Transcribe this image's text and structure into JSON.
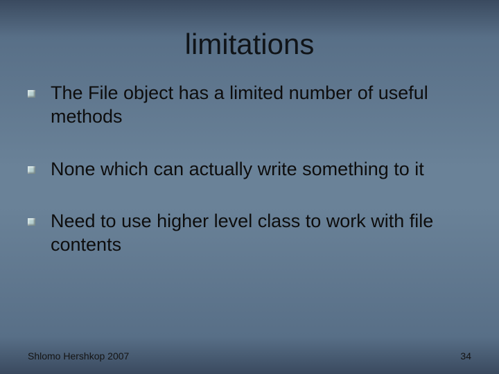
{
  "slide": {
    "title": "limitations",
    "bullets": [
      {
        "text": "The File object has a limited number of useful methods"
      },
      {
        "text": "None which can actually write something to it"
      },
      {
        "text": "Need to use higher level class to work with file contents"
      }
    ],
    "footer": {
      "left": "Shlomo Hershkop 2007",
      "right": "34"
    }
  }
}
